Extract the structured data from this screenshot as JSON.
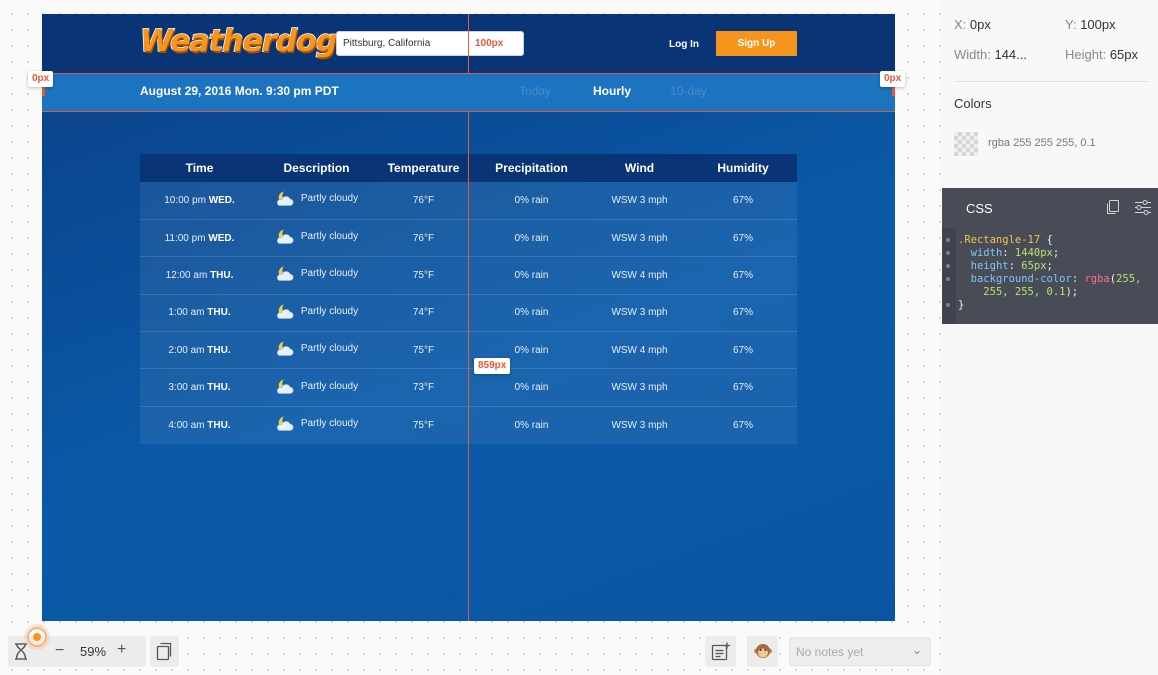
{
  "site": {
    "logo_text": "Weatherdog",
    "search_value": "Pittsburg, California",
    "login_label": "Log In",
    "signup_label": "Sign Up",
    "date_text": "August 29, 2016 Mon. 9:30 pm PDT",
    "tabs": [
      "Today",
      "Hourly",
      "10-day"
    ],
    "active_tab": "Hourly",
    "columns": [
      "Time",
      "Description",
      "Temperature",
      "Precipitation",
      "Wind",
      "Humidity"
    ],
    "rows": [
      {
        "time": "10:00 pm",
        "day": "WED.",
        "desc": "Partly cloudy",
        "temp": "76°F",
        "precip": "0% rain",
        "wind": "WSW 3 mph",
        "humidity": "67%"
      },
      {
        "time": "11:00 pm",
        "day": "WED.",
        "desc": "Partly cloudy",
        "temp": "76°F",
        "precip": "0% rain",
        "wind": "WSW 3 mph",
        "humidity": "67%"
      },
      {
        "time": "12:00 am",
        "day": "THU.",
        "desc": "Partly cloudy",
        "temp": "75°F",
        "precip": "0% rain",
        "wind": "WSW 4 mph",
        "humidity": "67%"
      },
      {
        "time": "1:00 am",
        "day": "THU.",
        "desc": "Partly cloudy",
        "temp": "74°F",
        "precip": "0% rain",
        "wind": "WSW 3 mph",
        "humidity": "67%"
      },
      {
        "time": "2:00 am",
        "day": "THU.",
        "desc": "Partly cloudy",
        "temp": "75°F",
        "precip": "0% rain",
        "wind": "WSW 4 mph",
        "humidity": "67%"
      },
      {
        "time": "3:00 am",
        "day": "THU.",
        "desc": "Partly cloudy",
        "temp": "73°F",
        "precip": "0% rain",
        "wind": "WSW 3 mph",
        "humidity": "67%"
      },
      {
        "time": "4:00 am",
        "day": "THU.",
        "desc": "Partly cloudy",
        "temp": "75°F",
        "precip": "0% rain",
        "wind": "WSW 3 mph",
        "humidity": "67%"
      }
    ],
    "row_icon": "partly-cloudy-night-icon"
  },
  "measurements": {
    "top_distance": "100px",
    "left_distance": "0px",
    "right_distance": "0px",
    "bottom_distance": "859px"
  },
  "inspector": {
    "x_label": "X:",
    "x_value": "0px",
    "y_label": "Y:",
    "y_value": "100px",
    "width_label": "Width:",
    "width_value": "144...",
    "height_label": "Height:",
    "height_value": "65px",
    "colors_title": "Colors",
    "color_value": "rgba 255 255 255, 0.1",
    "css_title": "CSS",
    "css": {
      "selector": ".Rectangle-17",
      "open_brace": " {",
      "width_prop": "width",
      "width_val": "1440px",
      "height_prop": "height",
      "height_val": "65px",
      "bg_prop": "background-color",
      "bg_fn": "rgba",
      "bg_args_1": "255,",
      "bg_args_2": "255, 255, 0.1",
      "close_brace": "}"
    }
  },
  "toolbar": {
    "zoom": "59%",
    "zoom_out": "−",
    "zoom_in": "+",
    "notes_placeholder": "No notes yet"
  },
  "colors": {
    "brand_orange": "#f7941d",
    "header_navy": "#093476",
    "measure_red": "#e8573c"
  }
}
